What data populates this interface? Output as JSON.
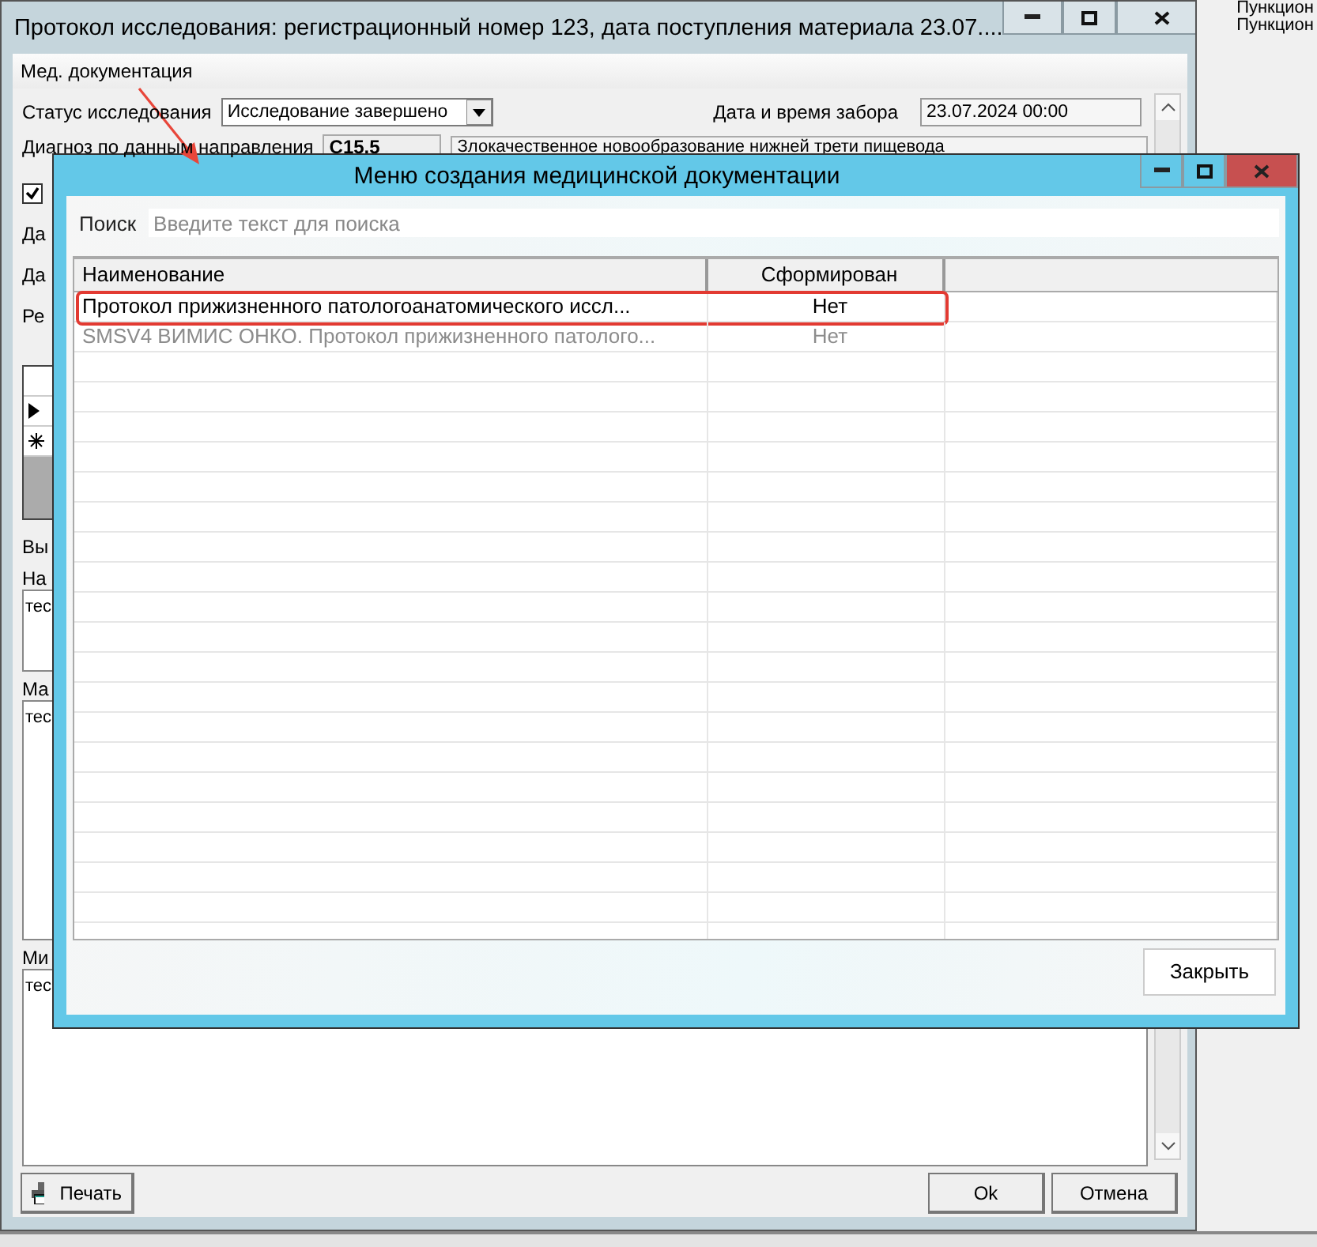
{
  "background_app": {
    "items": [
      "Пункцион",
      "Пункцион"
    ]
  },
  "window": {
    "title": "Протокол исследования: регистрационный номер 123, дата поступления материала 23.07....",
    "menu": [
      "Мед. документация"
    ],
    "status": {
      "label": "Статус исследования",
      "value": "Исследование завершено"
    },
    "sampling": {
      "label": "Дата и время забора",
      "value": "23.07.2024 00:00"
    },
    "diagnosis": {
      "label": "Диагноз по данным направления",
      "code": "C15.5",
      "text": "Злокачественное новообразование нижней трети пищевода"
    },
    "checkbox": {
      "checked": true
    },
    "labels": [
      "Да",
      "Да",
      "Ре"
    ],
    "section_label": "Вы",
    "fields": [
      {
        "label": "На",
        "value": "тес"
      },
      {
        "label": "Ма",
        "value": "тес"
      },
      {
        "label": "Ми",
        "value": "тес"
      }
    ],
    "buttons": {
      "print": "Печать",
      "ok": "Ok",
      "cancel": "Отмена"
    }
  },
  "dialog": {
    "title": "Меню создания медицинской документации",
    "search": {
      "label": "Поиск",
      "placeholder": "Введите текст для поиска"
    },
    "columns": [
      "Наименование",
      "Сформирован"
    ],
    "rows": [
      {
        "name": "Протокол прижизненного патологоанатомического иссл...",
        "formed": "Нет",
        "disabled": false,
        "highlighted": true
      },
      {
        "name": "SMSV4 ВИМИС ОНКО. Протокол прижизненного патолого...",
        "formed": "Нет",
        "disabled": true,
        "highlighted": false
      }
    ],
    "close_button": "Закрыть"
  }
}
